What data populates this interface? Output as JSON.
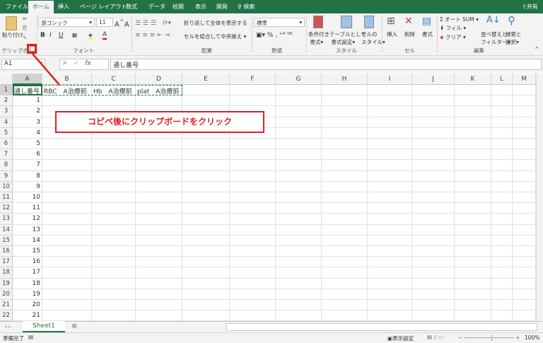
{
  "tabs": [
    "ファイル",
    "ホーム",
    "挿入",
    "ページ レイアウト",
    "数式",
    "データ",
    "校閲",
    "表示",
    "開発",
    "検索"
  ],
  "share": "共有",
  "ribbon": {
    "clipboard": {
      "paste": "貼り付け",
      "label": "クリップボード"
    },
    "font": {
      "name": "游ゴシック",
      "size": "11",
      "label": "フォント",
      "bold": "B",
      "italic": "I",
      "underline": "U"
    },
    "align": {
      "wrap": "折り返して全体を表示する",
      "merge": "セルを結合して中央揃え",
      "label": "配置"
    },
    "number": {
      "format": "標準",
      "percent": "%",
      "comma": ",",
      "label": "数値"
    },
    "styles": {
      "cond1": "条件付き",
      "cond2": "書式",
      "table1": "テーブルとして",
      "table2": "書式設定",
      "cell1": "セルの",
      "cell2": "スタイル",
      "label": "スタイル"
    },
    "cells": {
      "insert": "挿入",
      "delete": "削除",
      "format": "書式",
      "label": "セル"
    },
    "edit": {
      "autosum": "オート SUM",
      "fill": "フィル",
      "clear": "クリア",
      "sort1": "並べ替えと",
      "sort2": "フィルター",
      "find1": "検索と",
      "find2": "選択",
      "label": "編集"
    }
  },
  "formula_bar": {
    "name_box": "A1",
    "fx": "fx",
    "value": "通し番号"
  },
  "columns": [
    "A",
    "B",
    "C",
    "D",
    "E",
    "F",
    "G",
    "H",
    "I",
    "J",
    "K",
    "L",
    "M"
  ],
  "rows": [
    "1",
    "2",
    "3",
    "4",
    "5",
    "6",
    "7",
    "8",
    "9",
    "10",
    "11",
    "12",
    "13",
    "14",
    "15",
    "16",
    "17",
    "18",
    "19",
    "20",
    "21",
    "22"
  ],
  "header_cells": [
    "通し番号",
    "RBC　A治療前",
    "Hb　A治療前",
    "plat　A治療前"
  ],
  "col_a_values": [
    "1",
    "2",
    "3",
    "4",
    "5",
    "6",
    "7",
    "8",
    "9",
    "10",
    "11",
    "12",
    "13",
    "14",
    "15",
    "16",
    "17",
    "18",
    "19",
    "20",
    "21"
  ],
  "annotation": "コピペ後にクリップボードをクリック",
  "sheet_tab": "Sheet1",
  "status": {
    "ready": "準備完了",
    "display_settings": "表示設定",
    "zoom": "100%"
  },
  "colors": {
    "accent": "#217346",
    "annotation": "#e02020"
  }
}
